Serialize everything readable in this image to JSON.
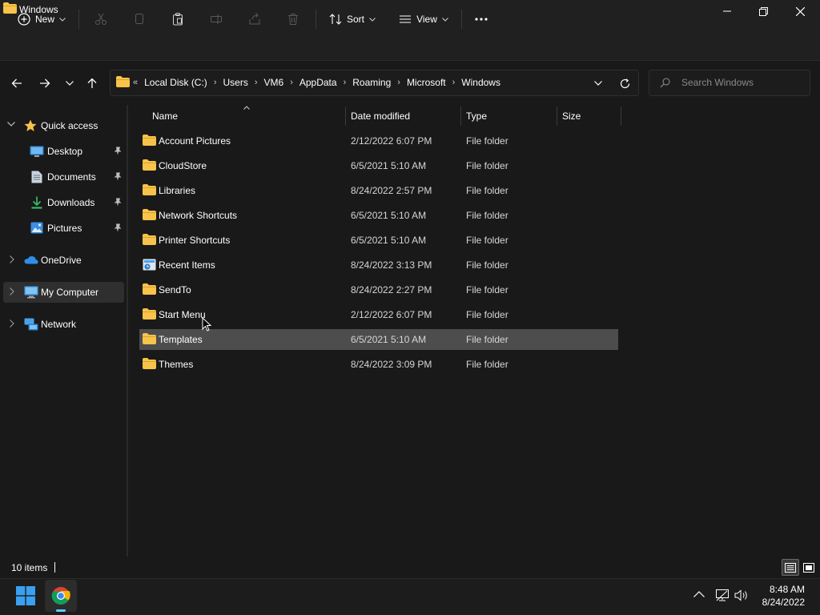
{
  "window": {
    "title": "Windows"
  },
  "toolbar": {
    "new_label": "New",
    "sort_label": "Sort",
    "view_label": "View"
  },
  "address": {
    "crumbs": [
      "Local Disk (C:)",
      "Users",
      "VM6",
      "AppData",
      "Roaming",
      "Microsoft",
      "Windows"
    ],
    "overflow_glyph": "«"
  },
  "search": {
    "placeholder": "Search Windows"
  },
  "sidebar": {
    "items": [
      {
        "label": "Quick access",
        "icon": "star-icon"
      },
      {
        "label": "Desktop",
        "icon": "desktop-icon"
      },
      {
        "label": "Documents",
        "icon": "documents-icon"
      },
      {
        "label": "Downloads",
        "icon": "downloads-icon"
      },
      {
        "label": "Pictures",
        "icon": "pictures-icon"
      },
      {
        "label": "OneDrive",
        "icon": "onedrive-icon"
      },
      {
        "label": "My Computer",
        "icon": "computer-icon"
      },
      {
        "label": "Network",
        "icon": "network-icon"
      }
    ]
  },
  "columns": {
    "name": "Name",
    "date": "Date modified",
    "type": "Type",
    "size": "Size"
  },
  "files": [
    {
      "name": "Account Pictures",
      "date": "2/12/2022 6:07 PM",
      "type": "File folder",
      "size": ""
    },
    {
      "name": "CloudStore",
      "date": "6/5/2021 5:10 AM",
      "type": "File folder",
      "size": ""
    },
    {
      "name": "Libraries",
      "date": "8/24/2022 2:57 PM",
      "type": "File folder",
      "size": ""
    },
    {
      "name": "Network Shortcuts",
      "date": "6/5/2021 5:10 AM",
      "type": "File folder",
      "size": ""
    },
    {
      "name": "Printer Shortcuts",
      "date": "6/5/2021 5:10 AM",
      "type": "File folder",
      "size": ""
    },
    {
      "name": "Recent Items",
      "date": "8/24/2022 3:13 PM",
      "type": "File folder",
      "size": ""
    },
    {
      "name": "SendTo",
      "date": "8/24/2022 2:27 PM",
      "type": "File folder",
      "size": ""
    },
    {
      "name": "Start Menu",
      "date": "2/12/2022 6:07 PM",
      "type": "File folder",
      "size": ""
    },
    {
      "name": "Templates",
      "date": "6/5/2021 5:10 AM",
      "type": "File folder",
      "size": ""
    },
    {
      "name": "Themes",
      "date": "8/24/2022 3:09 PM",
      "type": "File folder",
      "size": ""
    }
  ],
  "status": {
    "item_count": "10 items"
  },
  "taskbar": {
    "time": "8:48 AM",
    "date": "8/24/2022"
  },
  "colors": {
    "folder": "#f8c34a",
    "accent": "#60cdff",
    "hover_row": "#4d4d4d",
    "selected_nav": "#2f2f2f"
  }
}
